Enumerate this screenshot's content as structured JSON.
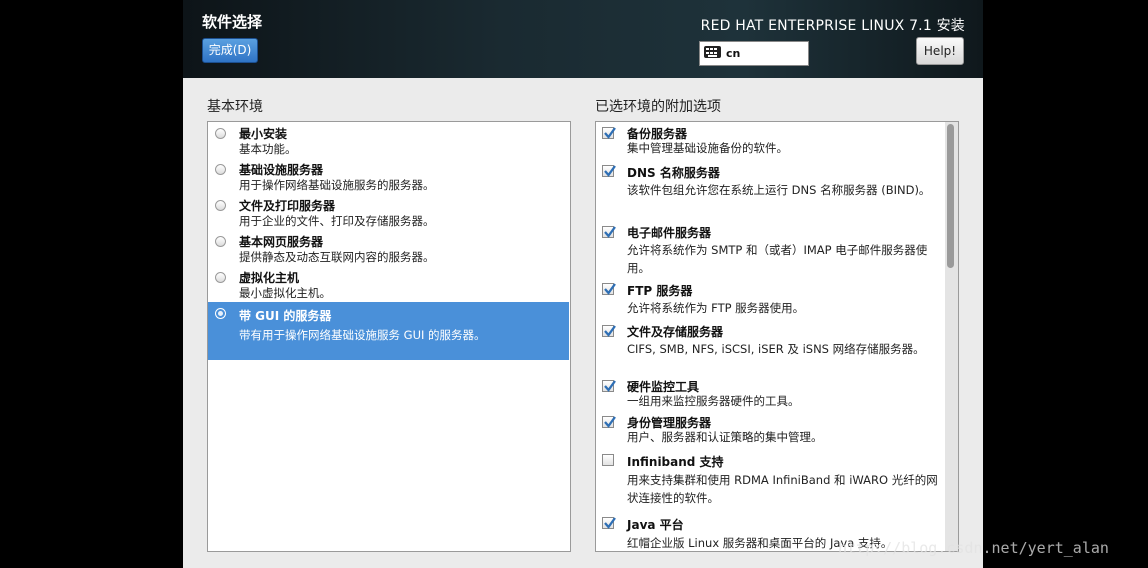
{
  "header": {
    "page_title": "软件选择",
    "done_label": "完成(D)",
    "product_title": "RED HAT ENTERPRISE LINUX 7.1 安装",
    "keyboard_layout": "cn",
    "help_label": "Help!"
  },
  "base_env": {
    "label": "基本环境",
    "items": [
      {
        "title": "最小安装",
        "desc": "基本功能。",
        "selected": false
      },
      {
        "title": "基础设施服务器",
        "desc": "用于操作网络基础设施服务的服务器。",
        "selected": false
      },
      {
        "title": "文件及打印服务器",
        "desc": "用于企业的文件、打印及存储服务器。",
        "selected": false
      },
      {
        "title": "基本网页服务器",
        "desc": "提供静态及动态互联网内容的服务器。",
        "selected": false
      },
      {
        "title": "虚拟化主机",
        "desc": "最小虚拟化主机。",
        "selected": false
      },
      {
        "title": "带 GUI 的服务器",
        "desc": "带有用于操作网络基础设施服务 GUI 的服务器。",
        "selected": true
      }
    ]
  },
  "addons": {
    "label": "已选环境的附加选项",
    "items": [
      {
        "title": "备份服务器",
        "desc": "集中管理基础设施备份的软件。",
        "checked": true
      },
      {
        "title": "DNS 名称服务器",
        "desc": "该软件包组允许您在系统上运行 DNS 名称服务器 (BIND)。",
        "checked": true
      },
      {
        "title": "电子邮件服务器",
        "desc": "允许将系统作为 SMTP 和（或者）IMAP 电子邮件服务器使用。",
        "checked": true
      },
      {
        "title": "FTP 服务器",
        "desc": "允许将系统作为 FTP 服务器使用。",
        "checked": true
      },
      {
        "title": "文件及存储服务器",
        "desc": "CIFS, SMB, NFS, iSCSI, iSER 及 iSNS 网络存储服务器。",
        "checked": true
      },
      {
        "title": "硬件监控工具",
        "desc": "一组用来监控服务器硬件的工具。",
        "checked": true
      },
      {
        "title": "身份管理服务器",
        "desc": "用户、服务器和认证策略的集中管理。",
        "checked": true
      },
      {
        "title": "Infiniband 支持",
        "desc": "用来支持集群和使用 RDMA InfiniBand 和 iWARO 光纤的网状连接性的软件。",
        "checked": false
      },
      {
        "title": "Java 平台",
        "desc": "红帽企业版 Linux 服务器和桌面平台的 Java 支持。",
        "checked": true
      }
    ]
  },
  "watermark": "http://blog.csdn.net/yert_alan",
  "colors": {
    "accent": "#4a90d9",
    "header_bg": "#1a2a31",
    "check": "#2f6fb5"
  }
}
